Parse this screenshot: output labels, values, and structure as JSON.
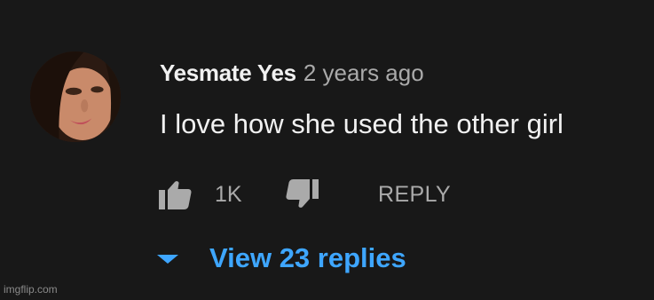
{
  "comment": {
    "author": "Yesmate Yes",
    "timestamp": "2 years ago",
    "text": "I love how she used the other girl ",
    "likes": "1K",
    "reply_label": "REPLY",
    "view_replies": "View 23 replies"
  },
  "icons": {
    "like": "thumbs-up-icon",
    "dislike": "thumbs-down-icon",
    "expand": "chevron-down-icon",
    "avatar": "avatar"
  },
  "colors": {
    "background": "#181818",
    "primary_text": "#f1f1f1",
    "secondary_text": "#aaaaaa",
    "link": "#3ea6ff"
  },
  "watermark": "imgflip.com"
}
